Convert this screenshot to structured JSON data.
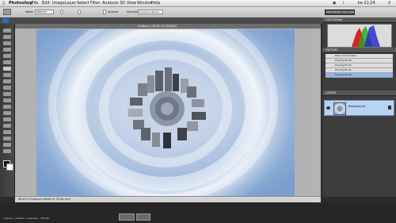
{
  "menubar": {
    "app_name": "Photoshop",
    "items": [
      "File",
      "Edit",
      "Image",
      "Layer",
      "Select",
      "Filter",
      "Analysis",
      "3D",
      "View",
      "Window",
      "Help"
    ],
    "clock": "ke 21:24"
  },
  "options": {
    "mode_label": "Mode:",
    "mode_value": "Normal",
    "sample_label": "Sample:",
    "sample_value": "Current & Below",
    "aligned_label": "Aligned",
    "workspace_button": "PHOTOSHOP CS5 ASIAT"
  },
  "document": {
    "title": "Untitled-1 @ 66.7% (RGB/8)"
  },
  "panels": {
    "histogram_title": "HISTOGRAM",
    "history_title": "HISTORY",
    "history_items": [
      "Polar Coordinates",
      "Healing Brush",
      "Healing Brush",
      "Healing Brush",
      "Healing Brush"
    ],
    "layers_title": "LAYERS",
    "layer_name": "Background"
  },
  "status": {
    "text": "66.67%   Exposure works in 32-bit only"
  },
  "taskbar": {
    "text": "1 items, 1 hidden, 1 selected · 778 GB"
  },
  "colors": {
    "sky": "#7ea6d6",
    "cloud": "#e9eef6",
    "history_selected": "#8fb6e7",
    "layer_selected": "#b9d3f2"
  }
}
